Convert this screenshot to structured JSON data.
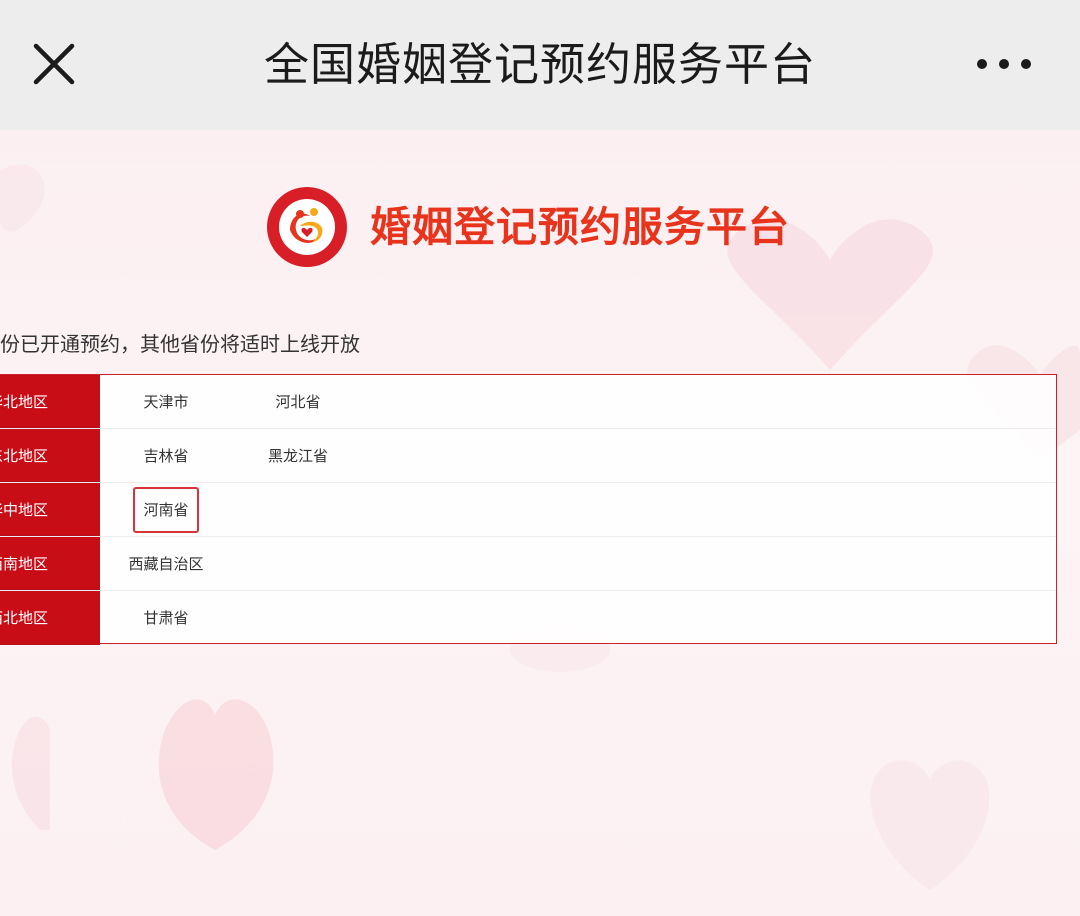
{
  "nav": {
    "title": "全国婚姻登记预约服务平台",
    "close_icon": "close-icon",
    "more_icon": "more-dots-icon"
  },
  "header": {
    "logo_icon": "marriage-registration-logo",
    "title": "婚姻登记预约服务平台"
  },
  "notice": "份已开通预约，其他省份将适时上线开放",
  "regions": [
    {
      "name": "华北地区",
      "provinces": [
        "天津市",
        "河北省"
      ]
    },
    {
      "name": "东北地区",
      "provinces": [
        "吉林省",
        "黑龙江省"
      ]
    },
    {
      "name": "华中地区",
      "provinces": [
        "河南省"
      ]
    },
    {
      "name": "西南地区",
      "provinces": [
        "西藏自治区"
      ]
    },
    {
      "name": "西北地区",
      "provinces": [
        "甘肃省"
      ]
    }
  ],
  "highlighted_province": "河南省",
  "colors": {
    "accent_red": "#c80d17",
    "title_red": "#e8331d",
    "highlight_border": "#d6333b"
  }
}
